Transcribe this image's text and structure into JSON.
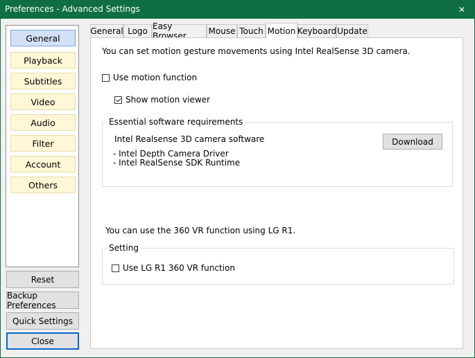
{
  "window": {
    "title": "Preferences - Advanced Settings",
    "close_glyph": "✕"
  },
  "nav": {
    "items": [
      "General",
      "Playback",
      "Subtitles",
      "Video",
      "Audio",
      "Filter",
      "Account",
      "Others"
    ],
    "active": "General"
  },
  "side_buttons": {
    "reset": "Reset",
    "backup": "Backup Preferences",
    "quick": "Quick Settings",
    "close": "Close"
  },
  "tabs": {
    "items": [
      "General",
      "Logo",
      "Easy Browser",
      "Mouse",
      "Touch",
      "Motion",
      "Keyboard",
      "Update"
    ],
    "active": "Motion"
  },
  "motion": {
    "intro": "You can set motion gesture movements using Intel RealSense 3D camera.",
    "use_motion_label": "Use motion function",
    "use_motion_checked": false,
    "show_viewer_label": "Show motion viewer",
    "show_viewer_checked": true,
    "requirements_title": "Essential software requirements",
    "software_name": "Intel Realsense 3D camera software",
    "req_line1": "- Intel Depth Camera Driver",
    "req_line2": "- Intel RealSense SDK Runtime",
    "download_label": "Download",
    "vr_text": "You can use the  360 VR function using LG R1.",
    "setting_title": "Setting",
    "lg_r1_label": "Use LG R1 360 VR function",
    "lg_r1_checked": false
  }
}
